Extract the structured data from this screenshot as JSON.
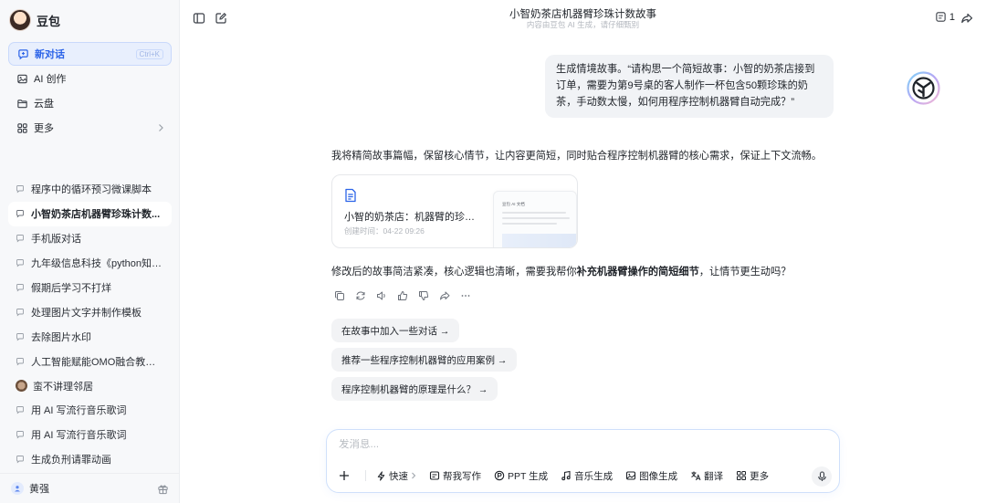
{
  "app": {
    "name": "豆包"
  },
  "sidebar": {
    "nav": [
      {
        "label": "新对话",
        "shortcut": "Ctrl+K",
        "icon": "new-chat-icon"
      },
      {
        "label": "AI 创作",
        "icon": "image-icon"
      },
      {
        "label": "云盘",
        "icon": "folder-icon"
      },
      {
        "label": "更多",
        "icon": "grid-icon"
      }
    ],
    "history": [
      "程序中的循环预习微课脚本",
      "小智奶茶店机器臂珍珠计数...",
      "手机版对话",
      "九年级信息科技《python知识...",
      "假期后学习不打烊",
      "处理图片文字并制作模板",
      "去除图片水印",
      "人工智能赋能OMO融合教学实...",
      "蛮不讲理邻居",
      "用 AI 写流行音乐歌词",
      "用 AI 写流行音乐歌词",
      "生成负刑请罪动画"
    ],
    "user": {
      "name": "黄强"
    }
  },
  "header": {
    "title": "小智奶茶店机器臂珍珠计数故事",
    "subtitle": "内容由豆包 AI 生成，请仔细甄别",
    "count": "1"
  },
  "chat": {
    "user_message": "生成情境故事。“请构思一个简短故事：小智的奶茶店接到订单，需要为第9号桌的客人制作一杯包含50颗珍珠的奶茶，手动数太慢，如何用程序控制机器臂自动完成？”",
    "reply_intro": "我将精简故事篇幅，保留核心情节，让内容更简短，同时贴合程序控制机器臂的核心需求，保证上下文流畅。",
    "doc": {
      "title": "小智的奶茶店：机器臂的珍珠计...",
      "time": "创建时间：04-22 09:26",
      "thumb_title": "豆包 AI 文档"
    },
    "reply_before": "修改后的故事简洁紧凑，核心逻辑也清晰，需要我帮你",
    "reply_bold": "补充机器臂操作的简短细节",
    "reply_after": "，让情节更生动吗？",
    "suggestions": [
      "在故事中加入一些对话 →",
      "推荐一些程序控制机器臂的应用案例 →",
      "程序控制机器臂的原理是什么？ →"
    ]
  },
  "composer": {
    "placeholder": "发消息...",
    "tools": [
      {
        "label": "快速",
        "icon": "lightning-icon"
      },
      {
        "label": "帮我写作",
        "icon": "write-icon"
      },
      {
        "label": "PPT 生成",
        "icon": "ppt-icon"
      },
      {
        "label": "音乐生成",
        "icon": "music-icon"
      },
      {
        "label": "图像生成",
        "icon": "image-icon"
      },
      {
        "label": "翻译",
        "icon": "translate-icon"
      },
      {
        "label": "更多",
        "icon": "grid-icon"
      }
    ]
  },
  "colors": {
    "accent": "#2b63e8",
    "active_bg": "#e8effd",
    "bubble_bg": "#f1f3f6"
  }
}
